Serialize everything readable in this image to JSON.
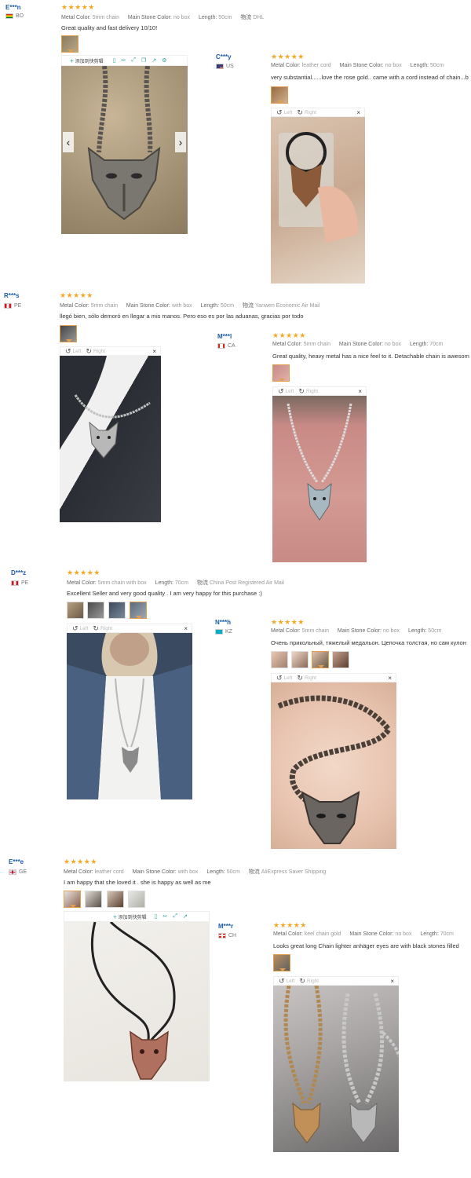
{
  "colors": {
    "star": "#f5a623",
    "username": "#1a5aa6",
    "selected_thumb": "#e0a050"
  },
  "viewer": {
    "left_label": "Left",
    "right_label": "Right",
    "close": "×"
  },
  "toolbar": {
    "add_label": "添加到快剪辑"
  },
  "labels": {
    "metal_color": "Metal Color:",
    "main_stone": "Main Stone Color:",
    "length": "Length:",
    "logistics": "物流"
  },
  "reviews": [
    {
      "user": "E***n",
      "country": "BO",
      "stars": "★★★★★",
      "metal": "5mm chain",
      "stone": "no box",
      "length": "50cm",
      "logistics": "DHL",
      "text": "Great quality and fast delivery 10/10!"
    },
    {
      "user": "C***y",
      "country": "US",
      "stars": "★★★★★",
      "metal": "leather cord",
      "stone": "no box",
      "length": "50cm",
      "text": "very substantial......love the rose gold.. came with a cord instead of chain...b"
    },
    {
      "user": "R***s",
      "country": "PE",
      "stars": "★★★★★",
      "metal": "5mm chain",
      "stone": "with box",
      "length": "50cm",
      "logistics": "Yanwen Economic Air Mail",
      "text": "llegó bien, sólo demoró en llegar a mis manos. Pero eso es por las aduanas, gracias por todo"
    },
    {
      "user": "M***l",
      "country": "CA",
      "stars": "★★★★★",
      "metal": "5mm chain",
      "stone": "no box",
      "length": "70cm",
      "text": "Great quality, heavy metal has a nice feel to it. Detachable chain is awesom"
    },
    {
      "user": "D***z",
      "country": "PE",
      "stars": "★★★★★",
      "metal": "5mm chain with box",
      "length": "70cm",
      "logistics": "China Post Registered Air Mail",
      "text": "Excellent Seller and very good quality . I am very happy for this purchase :)"
    },
    {
      "user": "N***h",
      "country": "KZ",
      "stars": "★★★★★",
      "metal": "5mm chain",
      "stone": "no box",
      "length": "50cm",
      "text": "Очень прикольный, тяжелый медальон. Цепочка толстая, но сам кулон"
    },
    {
      "user": "E***e",
      "country": "GE",
      "stars": "★★★★★",
      "metal": "leather cord",
      "stone": "with box",
      "length": "50cm",
      "logistics": "AliExpress Saver Shipping",
      "text": "I am happy that she loved it . she is happy as well as me"
    },
    {
      "user": "M***r",
      "country": "CH",
      "stars": "★★★★★",
      "metal": "keel chain gold",
      "stone": "no box",
      "length": "70cm",
      "text": "Looks great long Chain lighter anhäger eyes are with black stones filled"
    }
  ]
}
